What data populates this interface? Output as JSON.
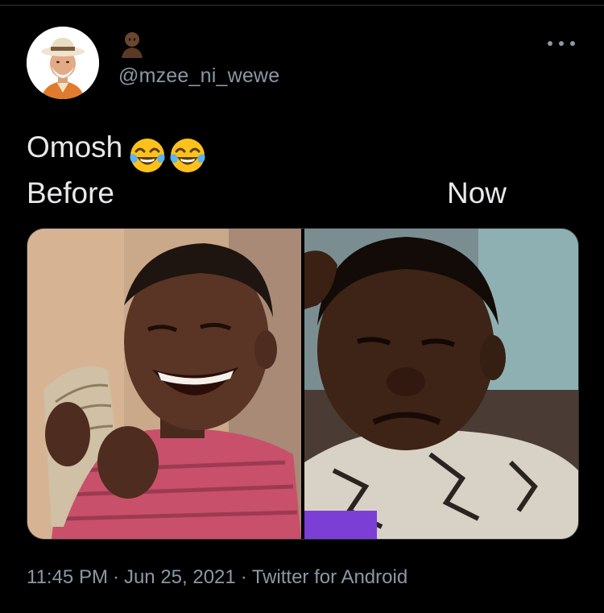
{
  "tweet": {
    "handle": "@mzee_ni_wewe",
    "display_name_icon": "person-emoji-icon",
    "text_line1": "Omosh",
    "text_line1_emojis": [
      "face-with-tears-of-joy-icon",
      "face-with-tears-of-joy-icon"
    ],
    "label_before": "Before",
    "label_now": "Now",
    "time": "11:45 PM",
    "separator": "·",
    "date": "Jun 25, 2021",
    "source": "Twitter for Android"
  },
  "colors": {
    "background": "#000000",
    "text": "#e7e9ea",
    "secondary_text": "#8b98a5",
    "border": "#2f3336"
  }
}
